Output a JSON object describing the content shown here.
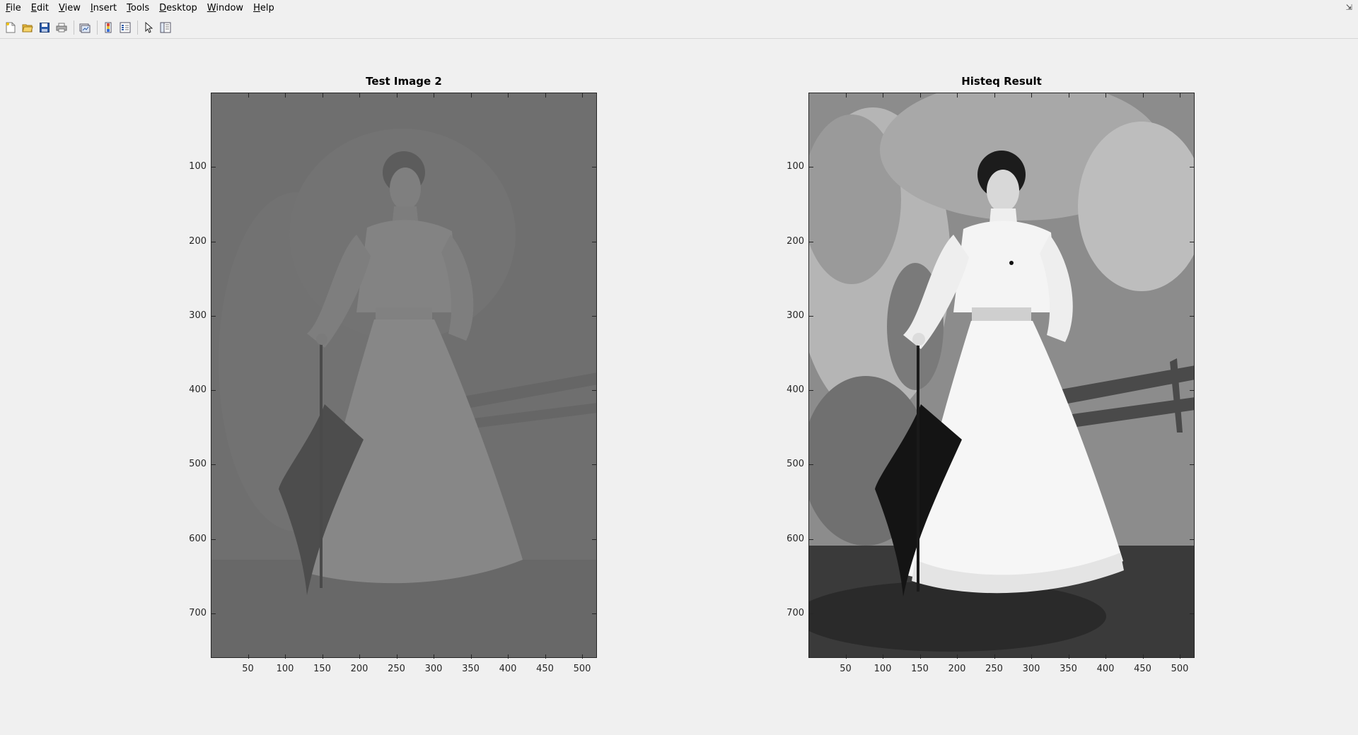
{
  "menubar": {
    "items": [
      {
        "mnemonic": "F",
        "rest": "ile"
      },
      {
        "mnemonic": "E",
        "rest": "dit"
      },
      {
        "mnemonic": "V",
        "rest": "iew"
      },
      {
        "mnemonic": "I",
        "rest": "nsert"
      },
      {
        "mnemonic": "T",
        "rest": "ools"
      },
      {
        "mnemonic": "D",
        "rest": "esktop"
      },
      {
        "mnemonic": "W",
        "rest": "indow"
      },
      {
        "mnemonic": "H",
        "rest": "elp"
      }
    ]
  },
  "toolbar": {
    "icons": [
      "new-figure-icon",
      "open-file-icon",
      "save-icon",
      "print-icon",
      "link-plot-icon",
      "insert-colorbar-icon",
      "insert-legend-icon",
      "edit-plot-arrow-icon",
      "property-inspector-icon"
    ]
  },
  "axes_left": {
    "title": "Test Image 2",
    "yticks": [
      "100",
      "200",
      "300",
      "400",
      "500",
      "600",
      "700"
    ],
    "xticks": [
      "50",
      "100",
      "150",
      "200",
      "250",
      "300",
      "350",
      "400",
      "450",
      "500"
    ]
  },
  "axes_right": {
    "title": "Histeq Result",
    "yticks": [
      "100",
      "200",
      "300",
      "400",
      "500",
      "600",
      "700"
    ],
    "xticks": [
      "50",
      "100",
      "150",
      "200",
      "250",
      "300",
      "350",
      "400",
      "450",
      "500"
    ]
  },
  "colors": {
    "background": "#f0f0f0",
    "low_contrast_gray": "#6e6e6e",
    "axis": "#262626"
  }
}
